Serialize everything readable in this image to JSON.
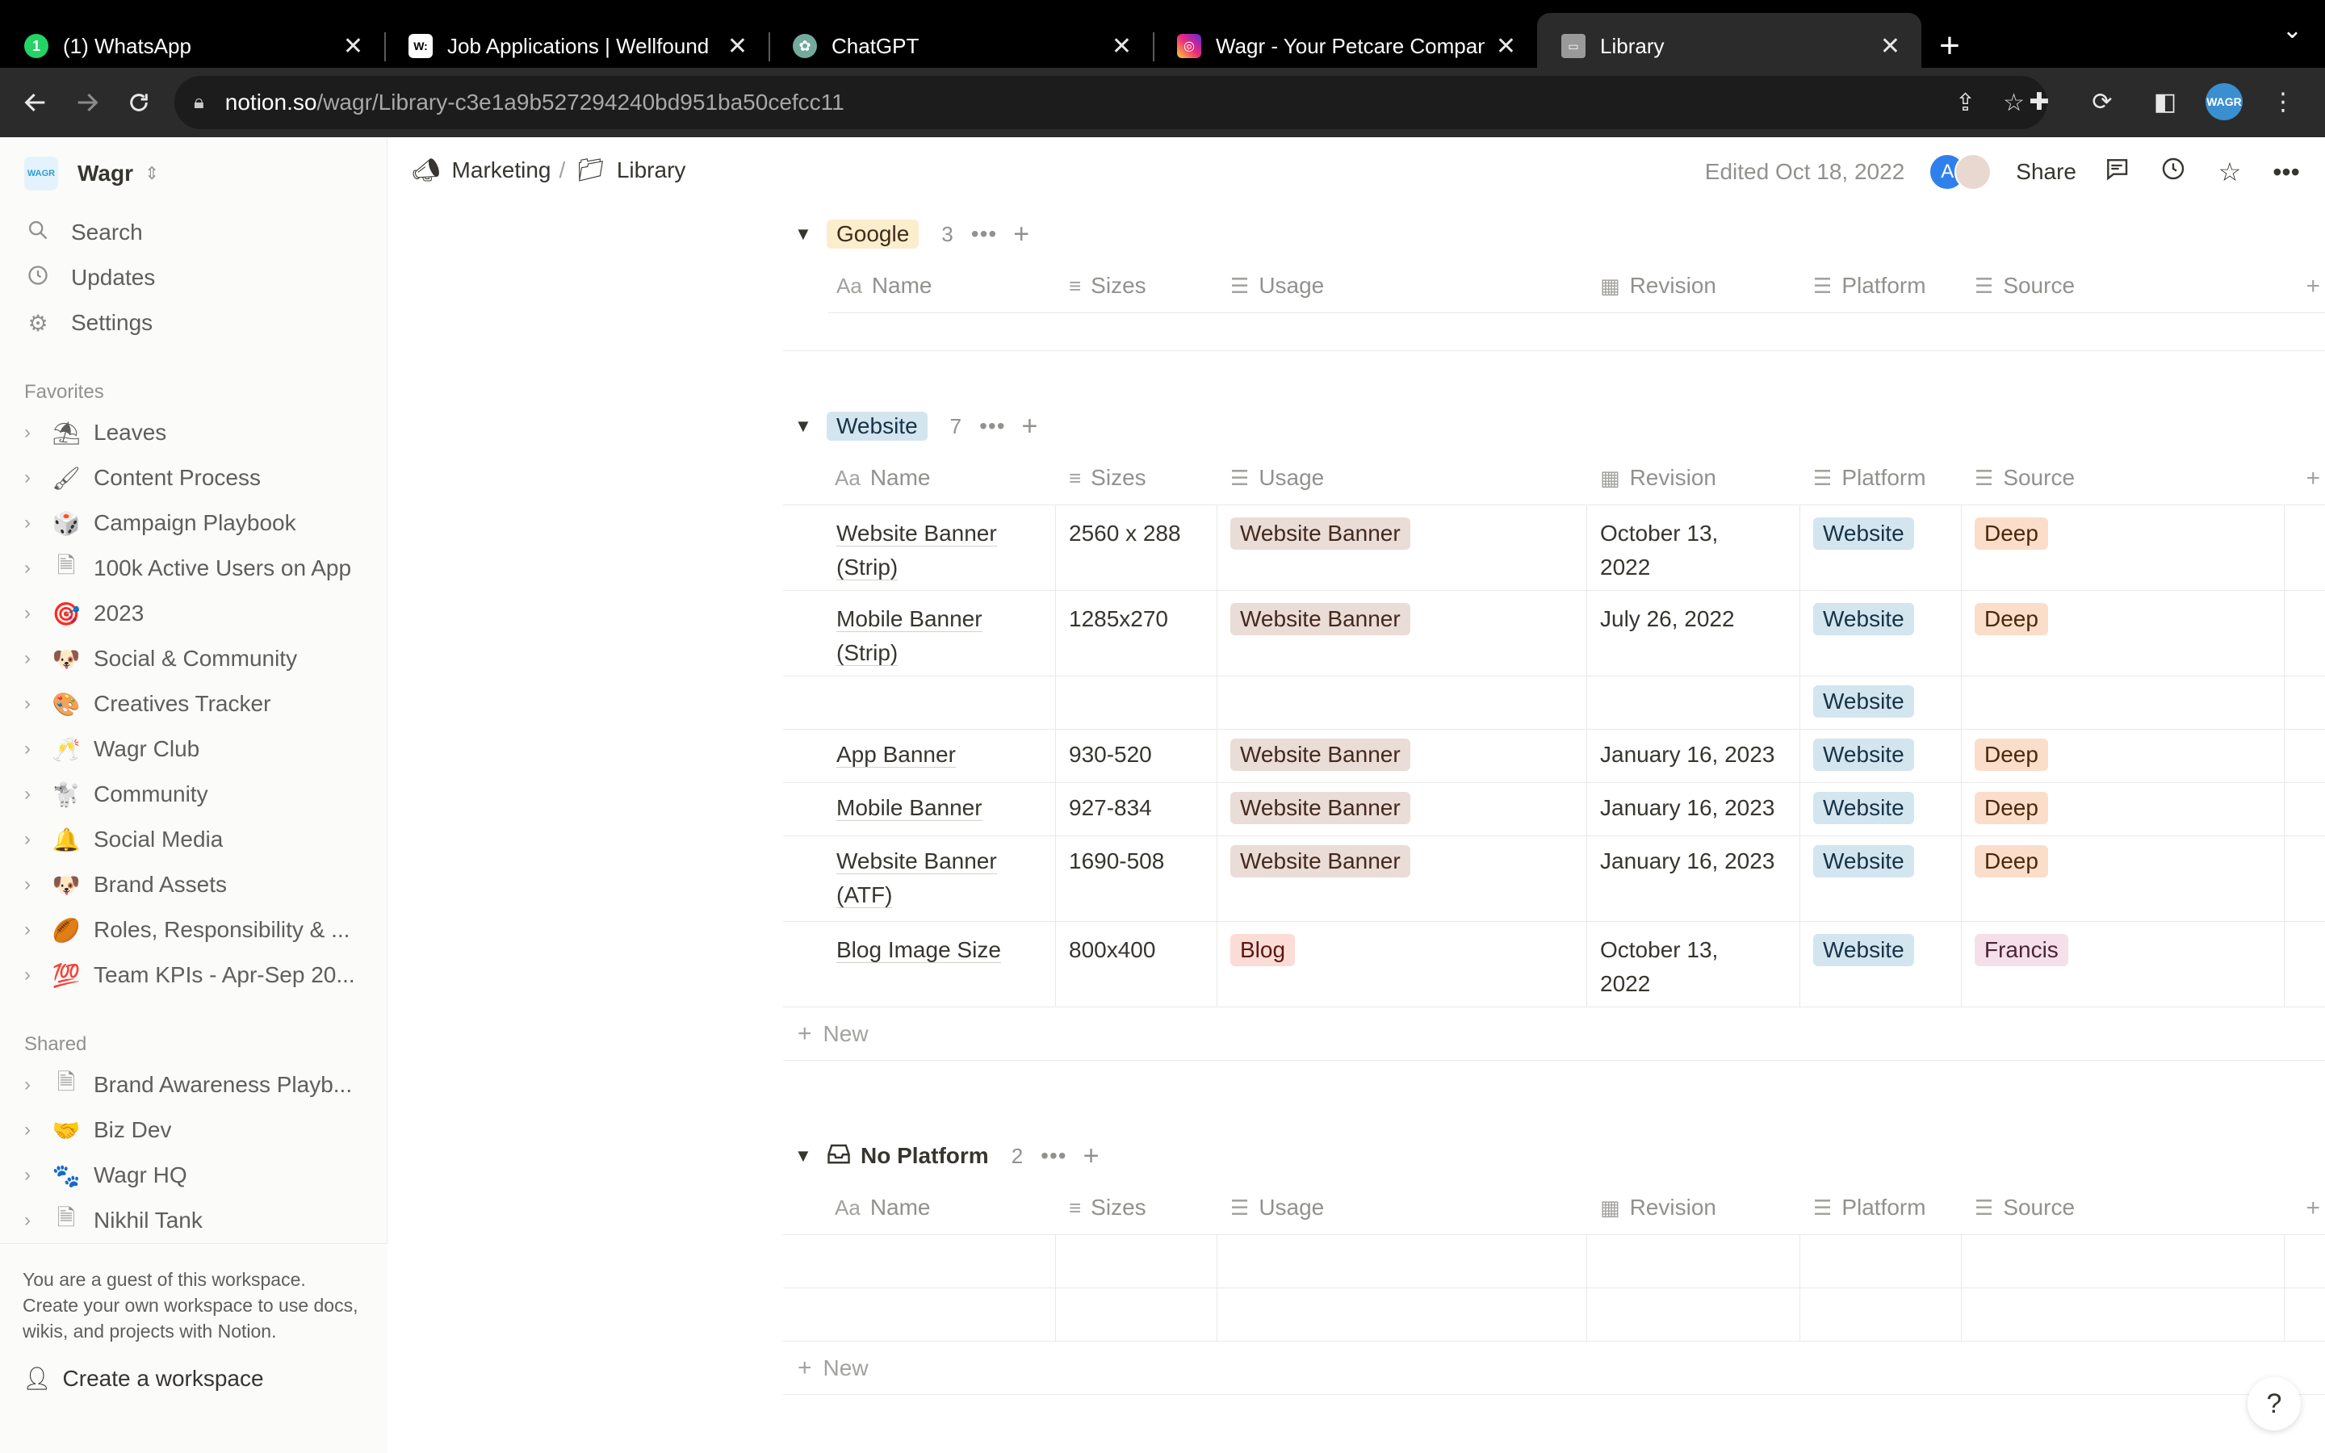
{
  "browser": {
    "tabs": [
      {
        "title": "(1) WhatsApp",
        "icon": "whatsapp-icon",
        "color": "#25d366"
      },
      {
        "title": "Job Applications | Wellfound (f",
        "icon": "wellfound-icon",
        "color": "#ffffff"
      },
      {
        "title": "ChatGPT",
        "icon": "chatgpt-icon",
        "color": "#74aa9c"
      },
      {
        "title": "Wagr - Your Petcare Companio",
        "icon": "instagram-icon",
        "color": "#e1306c"
      },
      {
        "title": "Library",
        "icon": "folder-icon",
        "color": "#a0a0a0"
      }
    ],
    "url_host": "notion.so",
    "url_path": "/wagr/Library-c3e1a9b527294240bd951ba50cefcc11"
  },
  "sidebar": {
    "workspace": "Wagr",
    "nav": [
      {
        "label": "Search",
        "icon": "search-icon"
      },
      {
        "label": "Updates",
        "icon": "clock-icon"
      },
      {
        "label": "Settings",
        "icon": "gear-icon"
      }
    ],
    "favorites_title": "Favorites",
    "favorites": [
      {
        "emoji": "⛱",
        "label": "Leaves"
      },
      {
        "emoji": "🖌",
        "label": "Content Process"
      },
      {
        "emoji": "🎲",
        "label": "Campaign Playbook"
      },
      {
        "emoji": "🗎",
        "label": "100k Active Users on App"
      },
      {
        "emoji": "🎯",
        "label": "2023"
      },
      {
        "emoji": "🐶",
        "label": "Social & Community"
      },
      {
        "emoji": "🎨",
        "label": "Creatives Tracker"
      },
      {
        "emoji": "🥂",
        "label": "Wagr Club"
      },
      {
        "emoji": "🐩",
        "label": "Community"
      },
      {
        "emoji": "🔔",
        "label": "Social Media"
      },
      {
        "emoji": "🐶",
        "label": "Brand Assets"
      },
      {
        "emoji": "🏉",
        "label": "Roles, Responsibility & ..."
      },
      {
        "emoji": "💯",
        "label": "Team KPIs - Apr-Sep 20..."
      }
    ],
    "shared_title": "Shared",
    "shared": [
      {
        "emoji": "🗎",
        "label": "Brand Awareness Playb..."
      },
      {
        "emoji": "🤝",
        "label": "Biz Dev"
      },
      {
        "emoji": "🐾",
        "label": "Wagr HQ"
      },
      {
        "emoji": "🗎",
        "label": "Nikhil Tank"
      }
    ],
    "guest_note": "You are a guest of this workspace. Create your own workspace to use docs, wikis, and projects with Notion.",
    "create_workspace": "Create a workspace"
  },
  "topbar": {
    "breadcrumbs": [
      {
        "icon": "megaphone-icon",
        "label": "Marketing"
      },
      {
        "icon": "folder-icon",
        "label": "Library"
      }
    ],
    "edited": "Edited Oct 18, 2022",
    "avatar_initial": "A",
    "share": "Share"
  },
  "columns": [
    {
      "label": "Name",
      "icon": "Aa"
    },
    {
      "label": "Sizes",
      "icon": "≡"
    },
    {
      "label": "Usage",
      "icon": "☰"
    },
    {
      "label": "Revision",
      "icon": "▦"
    },
    {
      "label": "Platform",
      "icon": "☰"
    },
    {
      "label": "Source",
      "icon": "☰"
    }
  ],
  "groups": {
    "google": {
      "label": "Google",
      "count": "3"
    },
    "website": {
      "label": "Website",
      "count": "7",
      "rows": [
        {
          "name_l1": "Website Banner",
          "name_l2": "(Strip)",
          "sizes": "2560 x 288",
          "usage": "Website Banner",
          "revision_l1": "October 13,",
          "revision_l2": "2022",
          "platform": "Website",
          "source": "Deep"
        },
        {
          "name_l1": "Mobile Banner",
          "name_l2": "(Strip)",
          "sizes": "1285x270",
          "usage": "Website Banner",
          "revision_l1": "July 26, 2022",
          "revision_l2": "",
          "platform": "Website",
          "source": "Deep"
        },
        {
          "name_l1": "",
          "name_l2": "",
          "sizes": "",
          "usage": "",
          "revision_l1": "",
          "revision_l2": "",
          "platform": "Website",
          "source": ""
        },
        {
          "name_l1": "App Banner",
          "name_l2": "",
          "sizes": "930-520",
          "usage": "Website Banner",
          "revision_l1": "January 16, 2023",
          "revision_l2": "",
          "platform": "Website",
          "source": "Deep"
        },
        {
          "name_l1": "Mobile Banner",
          "name_l2": "",
          "sizes": "927-834",
          "usage": "Website Banner",
          "revision_l1": "January 16, 2023",
          "revision_l2": "",
          "platform": "Website",
          "source": "Deep"
        },
        {
          "name_l1": "Website Banner",
          "name_l2": "(ATF)",
          "sizes": "1690-508",
          "usage": "Website Banner",
          "revision_l1": "January 16, 2023",
          "revision_l2": "",
          "platform": "Website",
          "source": "Deep"
        },
        {
          "name_l1": "Blog Image Size",
          "name_l2": "",
          "sizes": "800x400",
          "usage": "Blog",
          "revision_l1": "October 13,",
          "revision_l2": "2022",
          "platform": "Website",
          "source": "Francis"
        }
      ],
      "new_label": "New"
    },
    "no_platform": {
      "label": "No Platform",
      "count": "2",
      "new_label": "New"
    }
  },
  "help": "?"
}
